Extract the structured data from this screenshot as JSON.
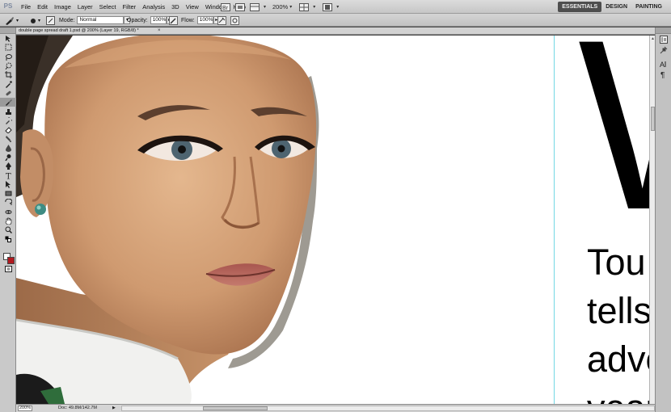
{
  "app": {
    "logo_text": "PS"
  },
  "menu": [
    "File",
    "Edit",
    "Image",
    "Layer",
    "Select",
    "Filter",
    "Analysis",
    "3D",
    "View",
    "Window",
    "Help"
  ],
  "appbar": {
    "zoom_level": "200%"
  },
  "workspaces": [
    "ESSENTIALS",
    "DESIGN",
    "PAINTING"
  ],
  "options": {
    "mode_label": "Mode:",
    "mode_value": "Normal",
    "opacity_label": "Opacity:",
    "opacity_value": "100%",
    "flow_label": "Flow:",
    "flow_value": "100%"
  },
  "document": {
    "tab_title": "double page spread draft 1.psd @ 200% (Layer 19, RGB/8) *",
    "close_glyph": "×",
    "big_letter": "W",
    "body_lines": [
      "Tou",
      "tells",
      "adve",
      "year"
    ]
  },
  "status": {
    "zoom": "200%",
    "doc_info": "Doc: 49.8M/142.7M"
  },
  "colors": {
    "foreground": "#ffffff",
    "background": "#b2191f",
    "guide": "#73d7e5",
    "active_workspace": "#4e4e4e"
  }
}
